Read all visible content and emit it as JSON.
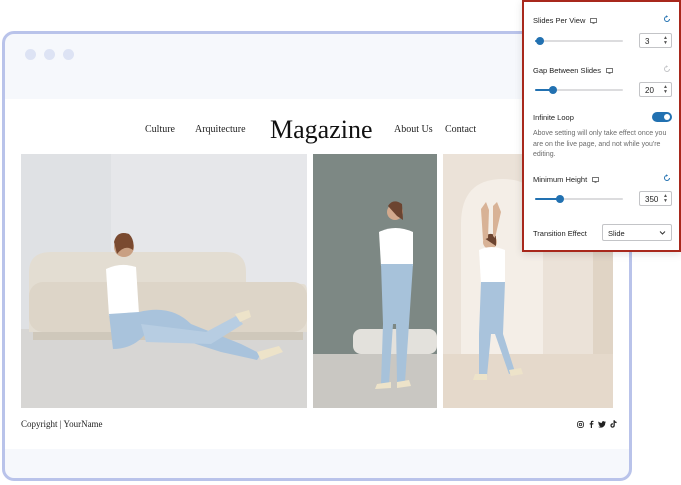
{
  "site": {
    "nav_left": [
      "Culture",
      "Arquitecture"
    ],
    "logo": "Magazine",
    "nav_right": [
      "About Us",
      "Contact"
    ],
    "footer_copy": "Copyright | YourName",
    "social_icons": [
      "instagram-icon",
      "facebook-icon",
      "twitter-icon",
      "tiktok-icon"
    ]
  },
  "panel": {
    "slides_per_view": {
      "label": "Slides Per View",
      "value": "3",
      "level": 0.06
    },
    "gap_between_slides": {
      "label": "Gap Between Slides",
      "value": "20",
      "level": 0.2
    },
    "infinite_loop": {
      "label": "Infinite Loop",
      "enabled": true,
      "help": "Above setting will only take effect once you are on the live page, and not while you're editing."
    },
    "minimum_height": {
      "label": "Minimum Height",
      "value": "350",
      "level": 0.28
    },
    "transition_effect": {
      "label": "Transition Effect",
      "value": "Slide"
    },
    "accent_color": "#2271b1",
    "highlight_border": "#a8281c"
  }
}
